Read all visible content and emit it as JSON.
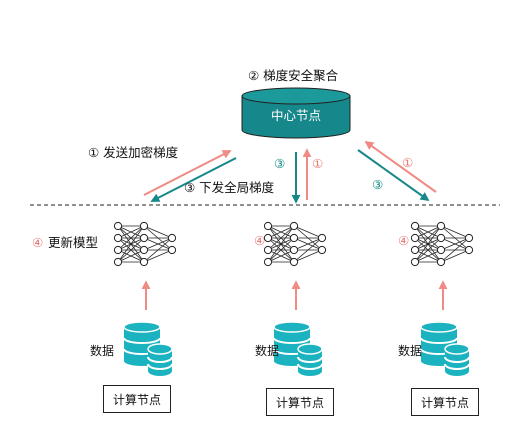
{
  "server": {
    "label": "中心节点",
    "aggregate_label": "② 梯度安全聚合"
  },
  "steps": {
    "send_label": "① 发送加密梯度",
    "broadcast_label": "③ 下发全局梯度",
    "update_label": "④ 更新模型",
    "mark_1": "①",
    "mark_3": "③",
    "mark_4": "④"
  },
  "nodes": [
    {
      "title": "计算节点",
      "data_label": "数据"
    },
    {
      "title": "计算节点",
      "data_label": "数据"
    },
    {
      "title": "计算节点",
      "data_label": "数据"
    }
  ],
  "colors": {
    "teal": "#16878a",
    "teal_icon": "#1bb3c0",
    "red_arrow": "#f08a84",
    "dark": "#222222"
  }
}
